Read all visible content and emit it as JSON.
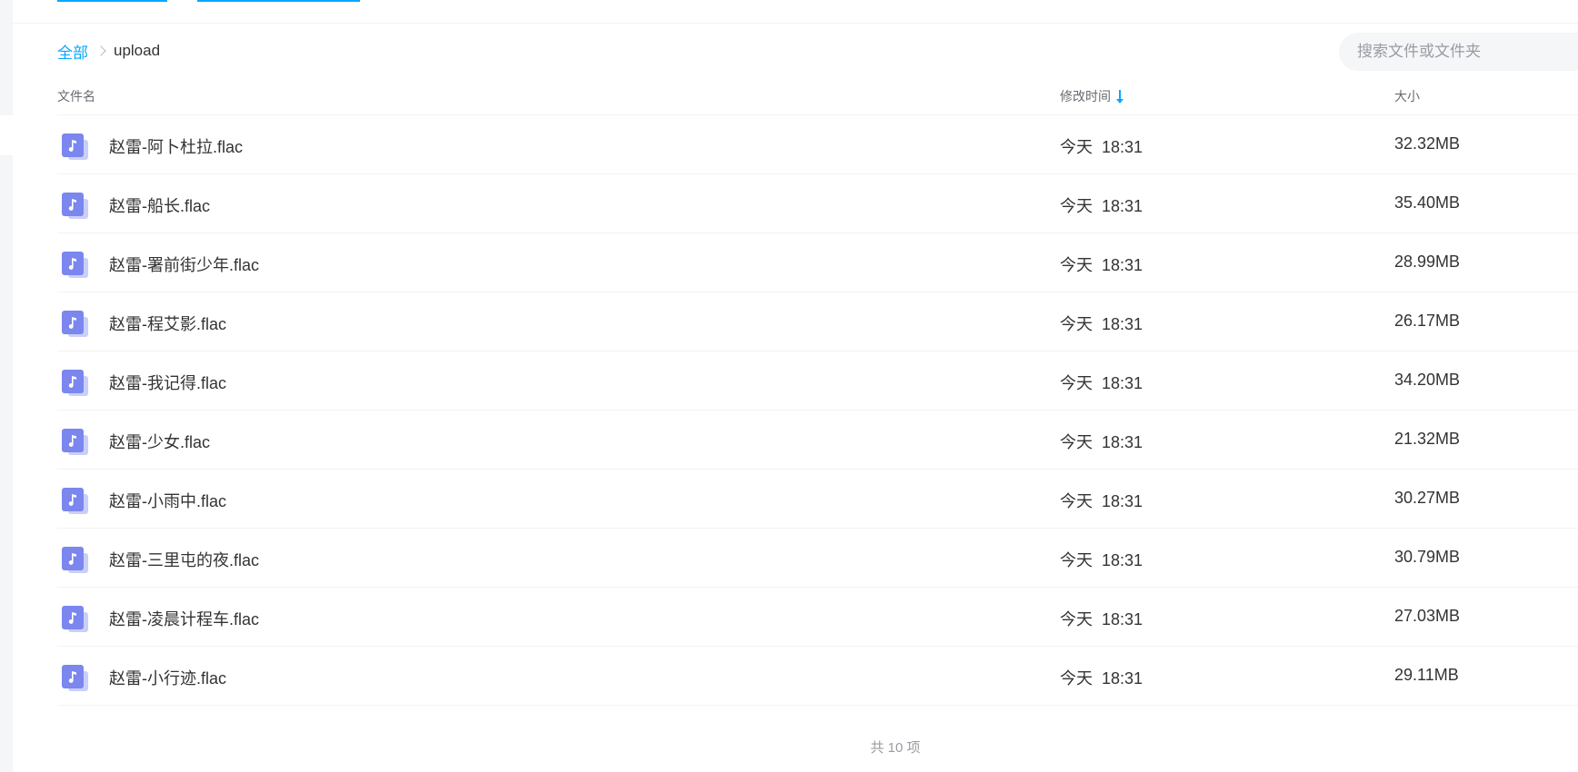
{
  "breadcrumb": {
    "root": "全部",
    "current": "upload"
  },
  "search": {
    "placeholder": "搜索文件或文件夹"
  },
  "columns": {
    "name": "文件名",
    "time": "修改时间",
    "size": "大小"
  },
  "files": [
    {
      "name": "赵雷-阿卜杜拉.flac",
      "day": "今天",
      "time": "18:31",
      "size": "32.32MB"
    },
    {
      "name": "赵雷-船长.flac",
      "day": "今天",
      "time": "18:31",
      "size": "35.40MB"
    },
    {
      "name": "赵雷-署前街少年.flac",
      "day": "今天",
      "time": "18:31",
      "size": "28.99MB"
    },
    {
      "name": "赵雷-程艾影.flac",
      "day": "今天",
      "time": "18:31",
      "size": "26.17MB"
    },
    {
      "name": "赵雷-我记得.flac",
      "day": "今天",
      "time": "18:31",
      "size": "34.20MB"
    },
    {
      "name": "赵雷-少女.flac",
      "day": "今天",
      "time": "18:31",
      "size": "21.32MB"
    },
    {
      "name": "赵雷-小雨中.flac",
      "day": "今天",
      "time": "18:31",
      "size": "30.27MB"
    },
    {
      "name": "赵雷-三里屯的夜.flac",
      "day": "今天",
      "time": "18:31",
      "size": "30.79MB"
    },
    {
      "name": "赵雷-凌晨计程车.flac",
      "day": "今天",
      "time": "18:31",
      "size": "27.03MB"
    },
    {
      "name": "赵雷-小行迹.flac",
      "day": "今天",
      "time": "18:31",
      "size": "29.11MB"
    }
  ],
  "footer": {
    "count_label": "共 10 项"
  },
  "icons": {
    "file": "music-file-icon",
    "sort": "sort-down-arrow-icon",
    "separator": "chevron-right-icon"
  },
  "colors": {
    "accent": "#06a7ff",
    "file_icon": "#7b86ee"
  }
}
